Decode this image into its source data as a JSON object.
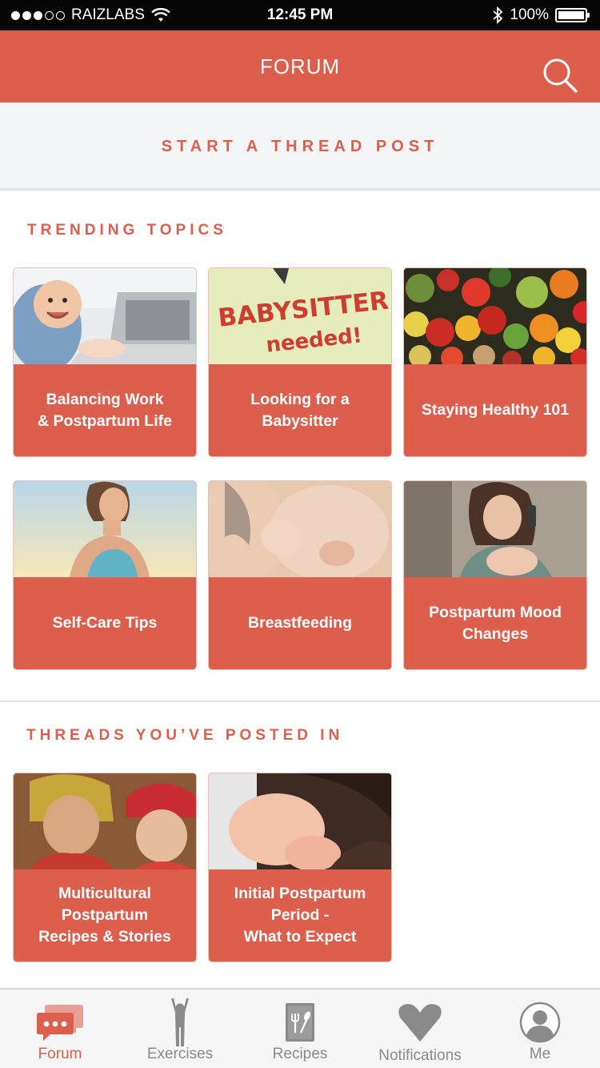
{
  "status_bar": {
    "carrier": "RAIZLABS",
    "time": "12:45 PM",
    "battery": "100%"
  },
  "nav": {
    "title": "FORUM"
  },
  "start_thread": {
    "label": "START A THREAD POST"
  },
  "trending": {
    "title": "TRENDING TOPICS",
    "cards": [
      {
        "label": "Balancing Work\n& Postpartum Life",
        "image": "baby-with-laptop"
      },
      {
        "label": "Looking for a\nBabysitter",
        "image": "babysitter-note",
        "sign_line1": "BABYSITTER",
        "sign_line2": "needed!"
      },
      {
        "label": "Staying Healthy 101",
        "image": "fruits-and-vegetables"
      },
      {
        "label": "Self-Care Tips",
        "image": "woman-in-sunlight"
      },
      {
        "label": "Breastfeeding",
        "image": "nursing-infant"
      },
      {
        "label": "Postpartum Mood\nChanges",
        "image": "mother-on-phone-with-newborn"
      }
    ]
  },
  "threads": {
    "title": "THREADS YOU’VE POSTED IN",
    "cards": [
      {
        "label": "Multicultural\nPostpartum\nRecipes & Stories",
        "image": "mother-and-child-in-hats"
      },
      {
        "label": "Initial Postpartum\nPeriod -\nWhat to Expect",
        "image": "parent-holding-newborn"
      }
    ]
  },
  "tabs": [
    {
      "label": "Forum",
      "icon": "chat-bubbles-icon",
      "active": true
    },
    {
      "label": "Exercises",
      "icon": "person-stretching-icon",
      "active": false
    },
    {
      "label": "Recipes",
      "icon": "recipe-book-icon",
      "active": false
    },
    {
      "label": "Notifications",
      "icon": "heart-icon",
      "active": false
    },
    {
      "label": "Me",
      "icon": "profile-icon",
      "active": false
    }
  ],
  "colors": {
    "accent": "#dc5e4d",
    "tab_inactive": "#8a8a8a",
    "background_light": "#f4f5f6"
  }
}
